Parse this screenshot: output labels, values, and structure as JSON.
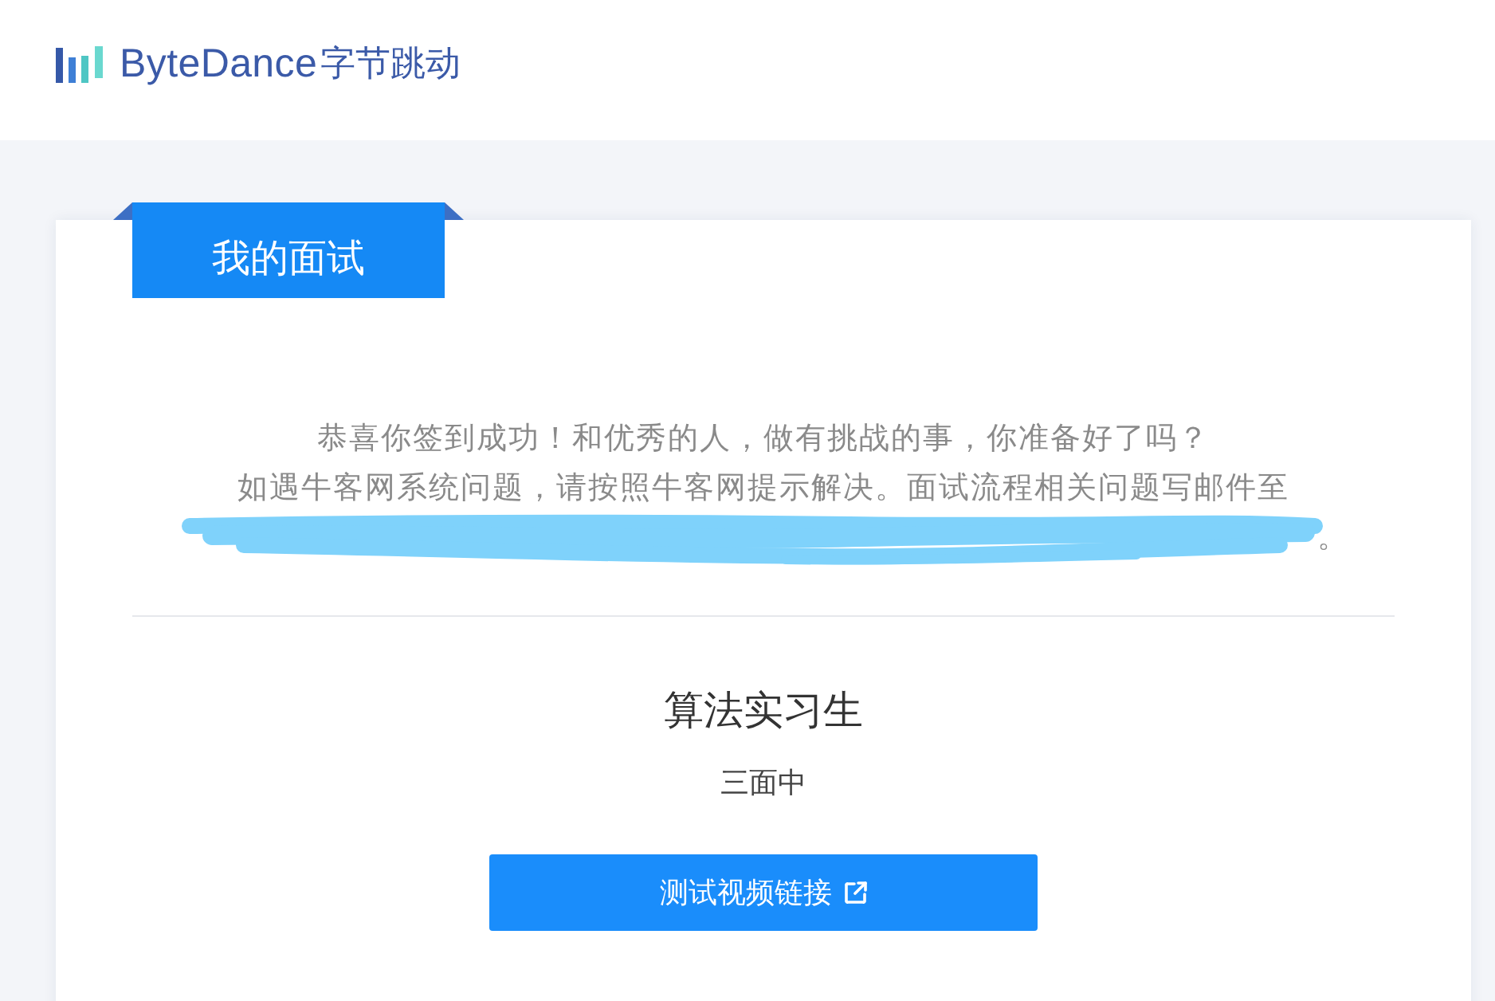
{
  "header": {
    "logo": {
      "wordmark": "ByteDance",
      "chinese_name": "字节跳动"
    }
  },
  "card": {
    "title": "我的面试",
    "notice": [
      "恭喜你签到成功！和优秀的人，做有挑战的事，你准备好了吗？",
      "如遇牛客网系统问题，请按照牛客网提示解决。面试流程相关问题写邮件至"
    ],
    "notice_tail": "。"
  },
  "position": {
    "title": "算法实习生",
    "status": "三面中"
  },
  "action_button": {
    "label": "测试视频链接"
  }
}
